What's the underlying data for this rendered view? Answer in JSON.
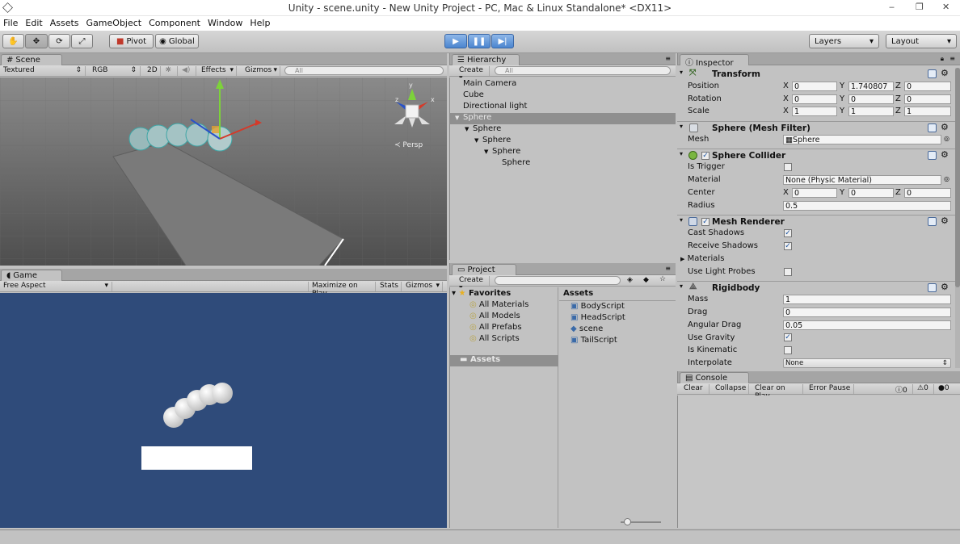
{
  "window": {
    "title": "Unity - scene.unity - New Unity Project - PC, Mac & Linux Standalone* <DX11>",
    "minimize": "‒",
    "maximize": "❐",
    "close": "✕"
  },
  "menu": [
    "File",
    "Edit",
    "Assets",
    "GameObject",
    "Component",
    "Window",
    "Help"
  ],
  "toolbar": {
    "pivot": "Pivot",
    "global": "Global",
    "layers": "Layers",
    "layout": "Layout"
  },
  "scene": {
    "tab": "Scene",
    "textured": "Textured",
    "rgb": "RGB",
    "mode2d": "2D",
    "effects": "Effects",
    "gizmos": "Gizmos",
    "search": "All",
    "persp": "Persp"
  },
  "game": {
    "tab": "Game",
    "aspect": "Free Aspect",
    "maximize": "Maximize on Play",
    "stats": "Stats",
    "gizmos": "Gizmos"
  },
  "hierarchy": {
    "tab": "Hierarchy",
    "create": "Create",
    "search": "All",
    "items": [
      {
        "label": "Main Camera",
        "depth": 0,
        "arrow": false,
        "selected": false
      },
      {
        "label": "Cube",
        "depth": 0,
        "arrow": false,
        "selected": false
      },
      {
        "label": "Directional light",
        "depth": 0,
        "arrow": false,
        "selected": false
      },
      {
        "label": "Sphere",
        "depth": 0,
        "arrow": true,
        "selected": true
      },
      {
        "label": "Sphere",
        "depth": 1,
        "arrow": true,
        "selected": false
      },
      {
        "label": "Sphere",
        "depth": 2,
        "arrow": true,
        "selected": false
      },
      {
        "label": "Sphere",
        "depth": 3,
        "arrow": true,
        "selected": false
      },
      {
        "label": "Sphere",
        "depth": 4,
        "arrow": false,
        "selected": false
      }
    ]
  },
  "project": {
    "tab": "Project",
    "create": "Create",
    "favorites": "Favorites",
    "fav_items": [
      "All Materials",
      "All Models",
      "All Prefabs",
      "All Scripts"
    ],
    "assets_label": "Assets",
    "assets_header": "Assets",
    "assets": [
      {
        "name": "BodyScript",
        "icon": "script-icon"
      },
      {
        "name": "HeadScript",
        "icon": "script-icon"
      },
      {
        "name": "scene",
        "icon": "unity-scene-icon"
      },
      {
        "name": "TailScript",
        "icon": "script-icon"
      }
    ]
  },
  "inspector": {
    "tab": "Inspector",
    "transform": {
      "title": "Transform",
      "position_label": "Position",
      "rotation_label": "Rotation",
      "scale_label": "Scale",
      "position": [
        "0",
        "1.740807",
        "0"
      ],
      "rotation": [
        "0",
        "0",
        "0"
      ],
      "scale": [
        "1",
        "1",
        "1"
      ]
    },
    "mesh_filter": {
      "title": "Sphere (Mesh Filter)",
      "mesh_label": "Mesh",
      "mesh": "Sphere"
    },
    "sphere_collider": {
      "title": "Sphere Collider",
      "is_trigger": "Is Trigger",
      "material_label": "Material",
      "material": "None (Physic Material)",
      "center_label": "Center",
      "center": [
        "0",
        "0",
        "0"
      ],
      "radius_label": "Radius",
      "radius": "0.5"
    },
    "mesh_renderer": {
      "title": "Mesh Renderer",
      "cast": "Cast Shadows",
      "receive": "Receive Shadows",
      "materials": "Materials",
      "light_probes": "Use Light Probes"
    },
    "rigidbody": {
      "title": "Rigidbody",
      "mass_label": "Mass",
      "mass": "1",
      "drag_label": "Drag",
      "drag": "0",
      "angular_label": "Angular Drag",
      "angular": "0.05",
      "gravity": "Use Gravity",
      "kinematic": "Is Kinematic",
      "interpolate_label": "Interpolate",
      "interpolate": "None"
    },
    "axes": [
      "X",
      "Y",
      "Z"
    ]
  },
  "console": {
    "tab": "Console",
    "clear": "Clear",
    "collapse": "Collapse",
    "clear_on_play": "Clear on Play",
    "error_pause": "Error Pause",
    "info_count": "0",
    "warn_count": "0",
    "error_count": "0"
  },
  "colors": {
    "game_bg": "#2f4b7a",
    "selection": "#8f8f8f",
    "play_blue": "#4b85cf"
  }
}
